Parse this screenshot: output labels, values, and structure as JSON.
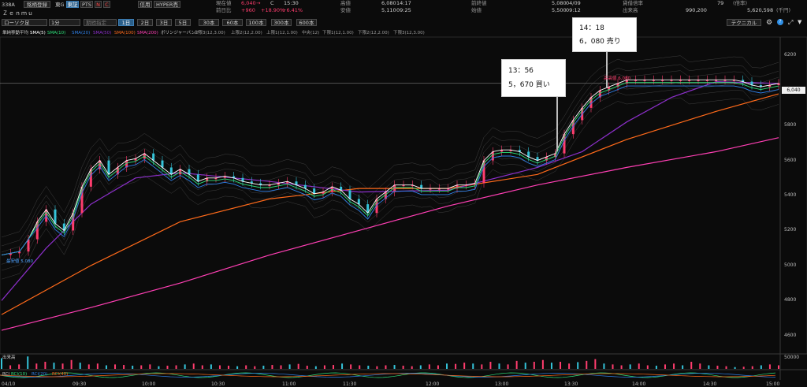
{
  "header": {
    "symbol_code": "338A",
    "btn_register": "銘柄登録",
    "market": "東G",
    "company_name": "Ｚｅｎｍｕ",
    "btn_toushou": "東証",
    "btn_pts": "PTS",
    "btn_n": "N",
    "btn_c": "C",
    "btn_credit": "信用",
    "btn_hyper": "HYPER売",
    "current_label": "現在値",
    "current_value": "6,040",
    "current_arrow": "→",
    "current_flag": "C",
    "current_time": "15:30",
    "change_label": "前日比",
    "change_value": "+960",
    "change_pct": "+18.90%",
    "change_pct2": "+6.41%",
    "high_label": "高値",
    "high_value": "6,080",
    "high_time": "14:17",
    "low_label": "安値",
    "low_value": "5,110",
    "low_time": "09:25",
    "prev_close_label": "前終値",
    "prev_close_value": "5,080",
    "prev_close_date": "04/09",
    "open_label": "始値",
    "open_value": "5,500",
    "open_time": "09:12",
    "margin_label": "貸借倍率",
    "margin_value": "79",
    "margin_unit": "(倍率)",
    "volume_label": "出来高",
    "volume_value": "990,200",
    "turnover_value": "5,620,598",
    "turnover_unit": "(千円)"
  },
  "toolbar": {
    "chart_type": "ローソク足",
    "interval": "1分",
    "period_placeholder": "期間指定",
    "ranges": [
      "1日",
      "2日",
      "3日",
      "5日",
      "30本",
      "60本",
      "100本",
      "300本",
      "600本"
    ],
    "active_range": 0,
    "technical_button": "テクニカル"
  },
  "indicators": {
    "sma_title": "単純移動平均",
    "sma5": "SMA(5)",
    "sma10": "SMA(10)",
    "sma20": "SMA(20)",
    "sma50": "SMA(50)",
    "sma100": "SMA(100)",
    "sma200": "SMA(200)",
    "bb_title": "ボリンジャーバンド",
    "bb1": "上限3(12,3.00)",
    "bb2": "上限2(12,2.00)",
    "bb3": "上限1(12,1.00)",
    "bb4": "中央(12)",
    "bb5": "下限1(12,1.00)",
    "bb6": "下限2(12,2.00)",
    "bb7": "下限3(12,3.00)",
    "colors": {
      "sma5": "#ffffff",
      "sma10": "#2ee07a",
      "sma20": "#2f7fe6",
      "sma50": "#8b2fc9",
      "sma100": "#ff6a1a",
      "sma200": "#ff3fb4",
      "bb": "#6a6a6a"
    }
  },
  "annotations": {
    "buy_time": "13：56",
    "buy_text": "5，670 買い",
    "sell_time": "14：18",
    "sell_text": "6，080 売り",
    "high_marker": "高高値 6,080",
    "low_marker": "最安値 5,080"
  },
  "volume_panel": {
    "label": "出来高",
    "scale": [
      "50000",
      "25000"
    ]
  },
  "rci_panel": {
    "label": "RCI",
    "items": [
      "RCI(10)",
      "RCI(20)",
      "RCI(40)"
    ]
  },
  "chart_data": {
    "type": "candlestick",
    "x_ticks": [
      "04/10",
      "09:30",
      "10:00",
      "10:30",
      "11:00",
      "11:30",
      "12:00",
      "13:00",
      "13:30",
      "14:00",
      "14:30",
      "15:00"
    ],
    "y_ticks": [
      4600,
      4800,
      5000,
      5200,
      5400,
      5600,
      5800,
      6000,
      6200
    ],
    "ylim": [
      4500,
      6300
    ],
    "last_price": "6,040",
    "close_path": [
      [
        0,
        5060
      ],
      [
        3,
        5070
      ],
      [
        6,
        5080
      ],
      [
        9,
        5150
      ],
      [
        12,
        5250
      ],
      [
        15,
        5320
      ],
      [
        18,
        5240
      ],
      [
        21,
        5200
      ],
      [
        24,
        5300
      ],
      [
        27,
        5450
      ],
      [
        30,
        5550
      ],
      [
        33,
        5600
      ],
      [
        36,
        5520
      ],
      [
        39,
        5560
      ],
      [
        42,
        5600
      ],
      [
        45,
        5610
      ],
      [
        48,
        5640
      ],
      [
        51,
        5600
      ],
      [
        54,
        5560
      ],
      [
        57,
        5520
      ],
      [
        60,
        5550
      ],
      [
        63,
        5520
      ],
      [
        66,
        5480
      ],
      [
        69,
        5500
      ],
      [
        72,
        5500
      ],
      [
        75,
        5510
      ],
      [
        78,
        5500
      ],
      [
        81,
        5480
      ],
      [
        84,
        5470
      ],
      [
        87,
        5460
      ],
      [
        90,
        5460
      ],
      [
        93,
        5470
      ],
      [
        96,
        5480
      ],
      [
        99,
        5460
      ],
      [
        102,
        5440
      ],
      [
        105,
        5410
      ],
      [
        108,
        5420
      ],
      [
        111,
        5450
      ],
      [
        114,
        5430
      ],
      [
        117,
        5380
      ],
      [
        120,
        5350
      ],
      [
        123,
        5300
      ],
      [
        126,
        5380
      ],
      [
        129,
        5420
      ],
      [
        132,
        5460
      ],
      [
        135,
        5460
      ],
      [
        138,
        5460
      ],
      [
        141,
        5440
      ],
      [
        144,
        5440
      ],
      [
        147,
        5440
      ],
      [
        150,
        5440
      ],
      [
        153,
        5460
      ],
      [
        156,
        5460
      ],
      [
        159,
        5470
      ],
      [
        162,
        5600
      ],
      [
        165,
        5650
      ],
      [
        168,
        5660
      ],
      [
        171,
        5660
      ],
      [
        174,
        5650
      ],
      [
        177,
        5620
      ],
      [
        180,
        5600
      ],
      [
        183,
        5620
      ],
      [
        186,
        5640
      ],
      [
        189,
        5750
      ],
      [
        192,
        5830
      ],
      [
        195,
        5900
      ],
      [
        198,
        5960
      ],
      [
        201,
        6000
      ],
      [
        204,
        6020
      ],
      [
        207,
        6040
      ],
      [
        210,
        6060
      ],
      [
        213,
        6060
      ],
      [
        216,
        6060
      ],
      [
        219,
        6060
      ],
      [
        222,
        6060
      ],
      [
        225,
        6060
      ],
      [
        228,
        6060
      ],
      [
        231,
        6060
      ],
      [
        234,
        6060
      ],
      [
        237,
        6060
      ],
      [
        240,
        6060
      ],
      [
        243,
        6060
      ],
      [
        246,
        6060
      ],
      [
        249,
        6050
      ],
      [
        252,
        6030
      ],
      [
        255,
        6020
      ],
      [
        258,
        6030
      ],
      [
        261,
        6040
      ]
    ],
    "series_sma": [
      {
        "name": "SMA(100)",
        "values": [
          [
            0,
            4720
          ],
          [
            30,
            5000
          ],
          [
            60,
            5250
          ],
          [
            90,
            5380
          ],
          [
            120,
            5440
          ],
          [
            150,
            5440
          ],
          [
            180,
            5520
          ],
          [
            210,
            5720
          ],
          [
            240,
            5880
          ],
          [
            261,
            5980
          ]
        ]
      },
      {
        "name": "SMA(200)",
        "values": [
          [
            0,
            4630
          ],
          [
            30,
            4760
          ],
          [
            60,
            4900
          ],
          [
            90,
            5060
          ],
          [
            120,
            5200
          ],
          [
            150,
            5340
          ],
          [
            180,
            5460
          ],
          [
            210,
            5560
          ],
          [
            240,
            5650
          ],
          [
            261,
            5730
          ]
        ]
      },
      {
        "name": "SMA(50)",
        "values": [
          [
            0,
            4800
          ],
          [
            15,
            5100
          ],
          [
            30,
            5350
          ],
          [
            45,
            5500
          ],
          [
            60,
            5530
          ],
          [
            90,
            5480
          ],
          [
            120,
            5420
          ],
          [
            150,
            5430
          ],
          [
            180,
            5560
          ],
          [
            195,
            5650
          ],
          [
            210,
            5820
          ],
          [
            225,
            5960
          ],
          [
            240,
            6050
          ],
          [
            261,
            6040
          ]
        ]
      }
    ],
    "volume": [
      60,
      20,
      25,
      70,
      30,
      40,
      35,
      30,
      50,
      35,
      25,
      30,
      20,
      25,
      22,
      18,
      20,
      25,
      15,
      18,
      20,
      25,
      30,
      20,
      25,
      20,
      18,
      15,
      20,
      15,
      18,
      22,
      20,
      25,
      28,
      18,
      15,
      20,
      22,
      30,
      25,
      20,
      18,
      15,
      20,
      22,
      18,
      15,
      20,
      25,
      20,
      30,
      28,
      35,
      30,
      25,
      40,
      30,
      25,
      45,
      35,
      40,
      50,
      35,
      40,
      30,
      38,
      45,
      55,
      30,
      25,
      20,
      25,
      30,
      20,
      18,
      25,
      30,
      20,
      40,
      30,
      20,
      18,
      15,
      10,
      12,
      15,
      20,
      25,
      20
    ]
  }
}
